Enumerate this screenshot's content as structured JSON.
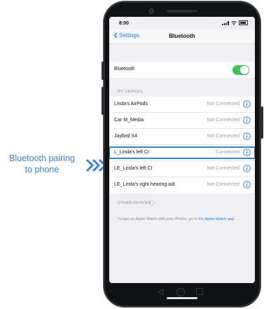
{
  "annotation": {
    "line1": "Bluetooth pairing",
    "line2": "to phone"
  },
  "status_bar": {
    "time": "8:00"
  },
  "nav": {
    "back_label": "Settings",
    "title": "Bluetooth"
  },
  "bluetooth_toggle": {
    "label": "Bluetooth",
    "on": true
  },
  "my_devices": {
    "header": "MY DEVICES",
    "items": [
      {
        "name": "Linda's AirPods",
        "status": "Not Connected"
      },
      {
        "name": "Car M_Media",
        "status": "Not Connected"
      },
      {
        "name": "Jaybird X4",
        "status": "Not Connected"
      },
      {
        "name": "L_Linda's left CI",
        "status": "Connected"
      },
      {
        "name": "LE_Linda's left CI",
        "status": "Not Connected"
      },
      {
        "name": "LE_Linda's right hearing aid",
        "status": "Not Connected"
      }
    ]
  },
  "other_devices": {
    "header": "OTHER DEVICES",
    "hint_text": "To pair an Apple Watch with your iPhone, go to the",
    "hint_link": "Apple Watch app."
  },
  "colors": {
    "accent": "#1a7cf0",
    "toggle_on": "#45c35a",
    "highlight": "#3b7fd6",
    "annotation_text": "#3a7fd3"
  },
  "icons": {
    "chevrons": "double-chevron-right-icon",
    "info": "info-circle-icon",
    "back": "chevron-left-icon"
  }
}
